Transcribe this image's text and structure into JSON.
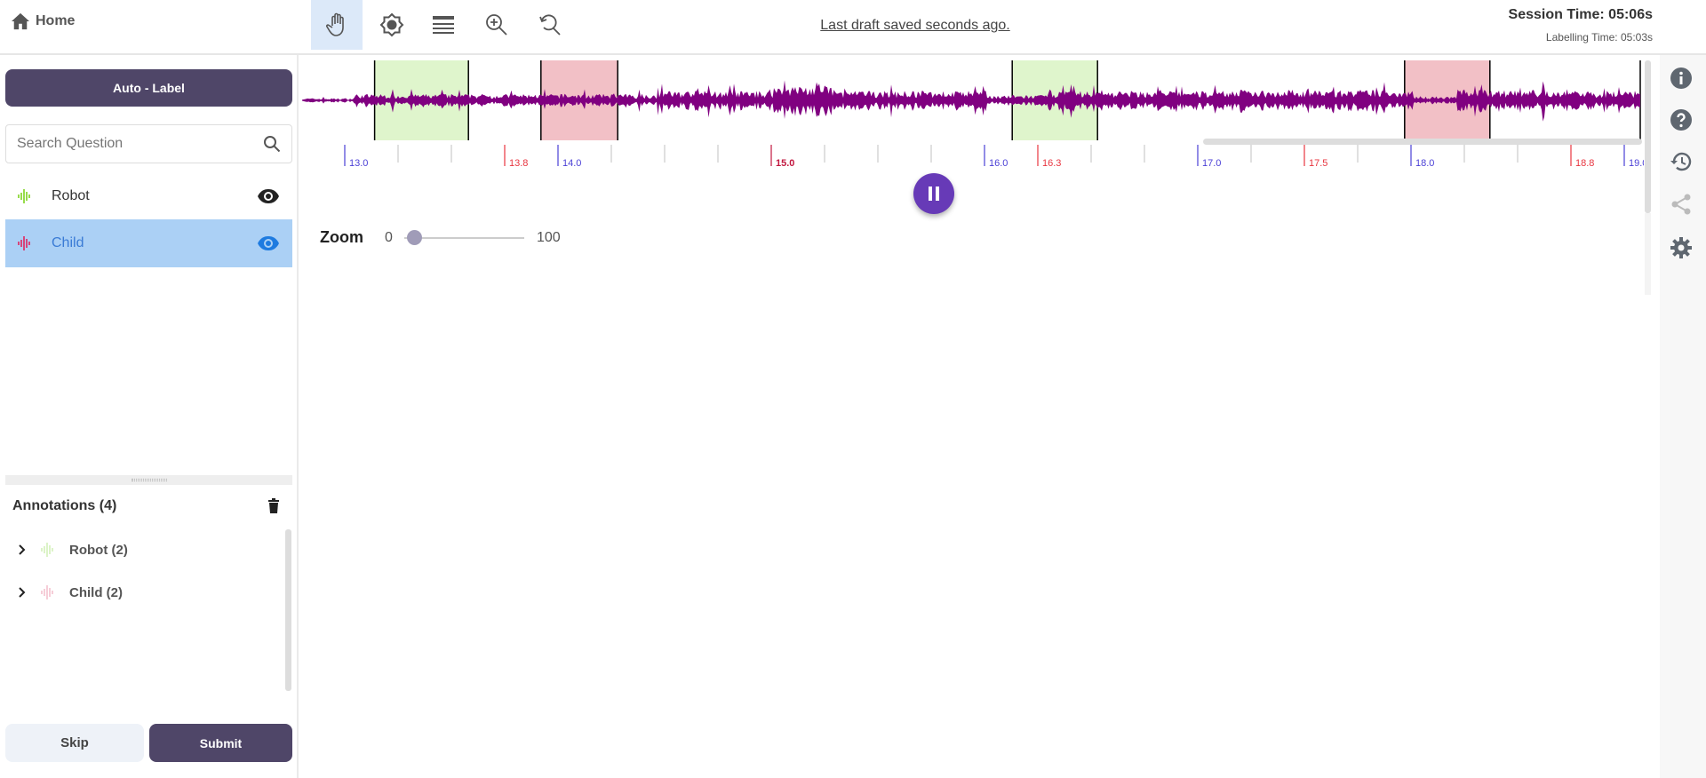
{
  "header": {
    "home_label": "Home",
    "draft_status": "Last draft saved seconds ago.",
    "session_time": "Session Time: 05:06s",
    "labelling_time": "Labelling Time: 05:03s",
    "tools": [
      "hand-icon",
      "brightness-icon",
      "menu-lines-icon",
      "zoom-in-icon",
      "zoom-reset-icon"
    ]
  },
  "sidebar": {
    "auto_label": "Auto - Label",
    "search_placeholder": "Search Question",
    "labels": [
      {
        "name": "Robot",
        "color": "#7ed321",
        "selected": false
      },
      {
        "name": "Child",
        "color": "#e0245e",
        "selected": true
      }
    ],
    "annotations_title": "Annotations (4)",
    "annotation_groups": [
      {
        "label": "Robot (2)"
      },
      {
        "label": "Child (2)"
      }
    ],
    "skip": "Skip",
    "submit": "Submit"
  },
  "timeline": {
    "ticks": [
      {
        "t": 13.0,
        "label": "13.0",
        "color": "#4a3fd6"
      },
      {
        "t": 13.25,
        "label": ""
      },
      {
        "t": 13.5,
        "label": ""
      },
      {
        "t": 13.75,
        "label": "13.8",
        "color": "#e8343f"
      },
      {
        "t": 14.0,
        "label": "14.0",
        "color": "#4a3fd6"
      },
      {
        "t": 14.25,
        "label": ""
      },
      {
        "t": 14.5,
        "label": ""
      },
      {
        "t": 14.75,
        "label": ""
      },
      {
        "t": 15.0,
        "label": "15.0",
        "color": "#c2173f"
      },
      {
        "t": 15.25,
        "label": ""
      },
      {
        "t": 15.5,
        "label": ""
      },
      {
        "t": 15.75,
        "label": ""
      },
      {
        "t": 16.0,
        "label": "16.0",
        "color": "#4a3fd6"
      },
      {
        "t": 16.25,
        "label": "16.3",
        "color": "#e8343f"
      },
      {
        "t": 16.5,
        "label": ""
      },
      {
        "t": 16.75,
        "label": ""
      },
      {
        "t": 17.0,
        "label": "17.0",
        "color": "#4a3fd6"
      },
      {
        "t": 17.25,
        "label": ""
      },
      {
        "t": 17.5,
        "label": "17.5",
        "color": "#e8343f"
      },
      {
        "t": 17.75,
        "label": ""
      },
      {
        "t": 18.0,
        "label": "18.0",
        "color": "#4a3fd6"
      },
      {
        "t": 18.25,
        "label": ""
      },
      {
        "t": 18.5,
        "label": ""
      },
      {
        "t": 18.75,
        "label": "18.8",
        "color": "#e8343f"
      },
      {
        "t": 19.0,
        "label": "19.0",
        "color": "#4a3fd6"
      }
    ],
    "regions": [
      {
        "start": 13.14,
        "end": 13.58,
        "color": "#dff5cc"
      },
      {
        "start": 13.92,
        "end": 14.28,
        "color": "#f2c0c6"
      },
      {
        "start": 16.13,
        "end": 16.53,
        "color": "#dff5cc"
      },
      {
        "start": 17.97,
        "end": 18.37,
        "color": "#f2c0c6"
      }
    ],
    "wave_color": "#800080"
  },
  "zoom": {
    "label": "Zoom",
    "min": "0",
    "max": "100",
    "value": 5
  },
  "rail": [
    "info-icon",
    "help-icon",
    "history-icon",
    "share-icon",
    "settings-icon"
  ]
}
